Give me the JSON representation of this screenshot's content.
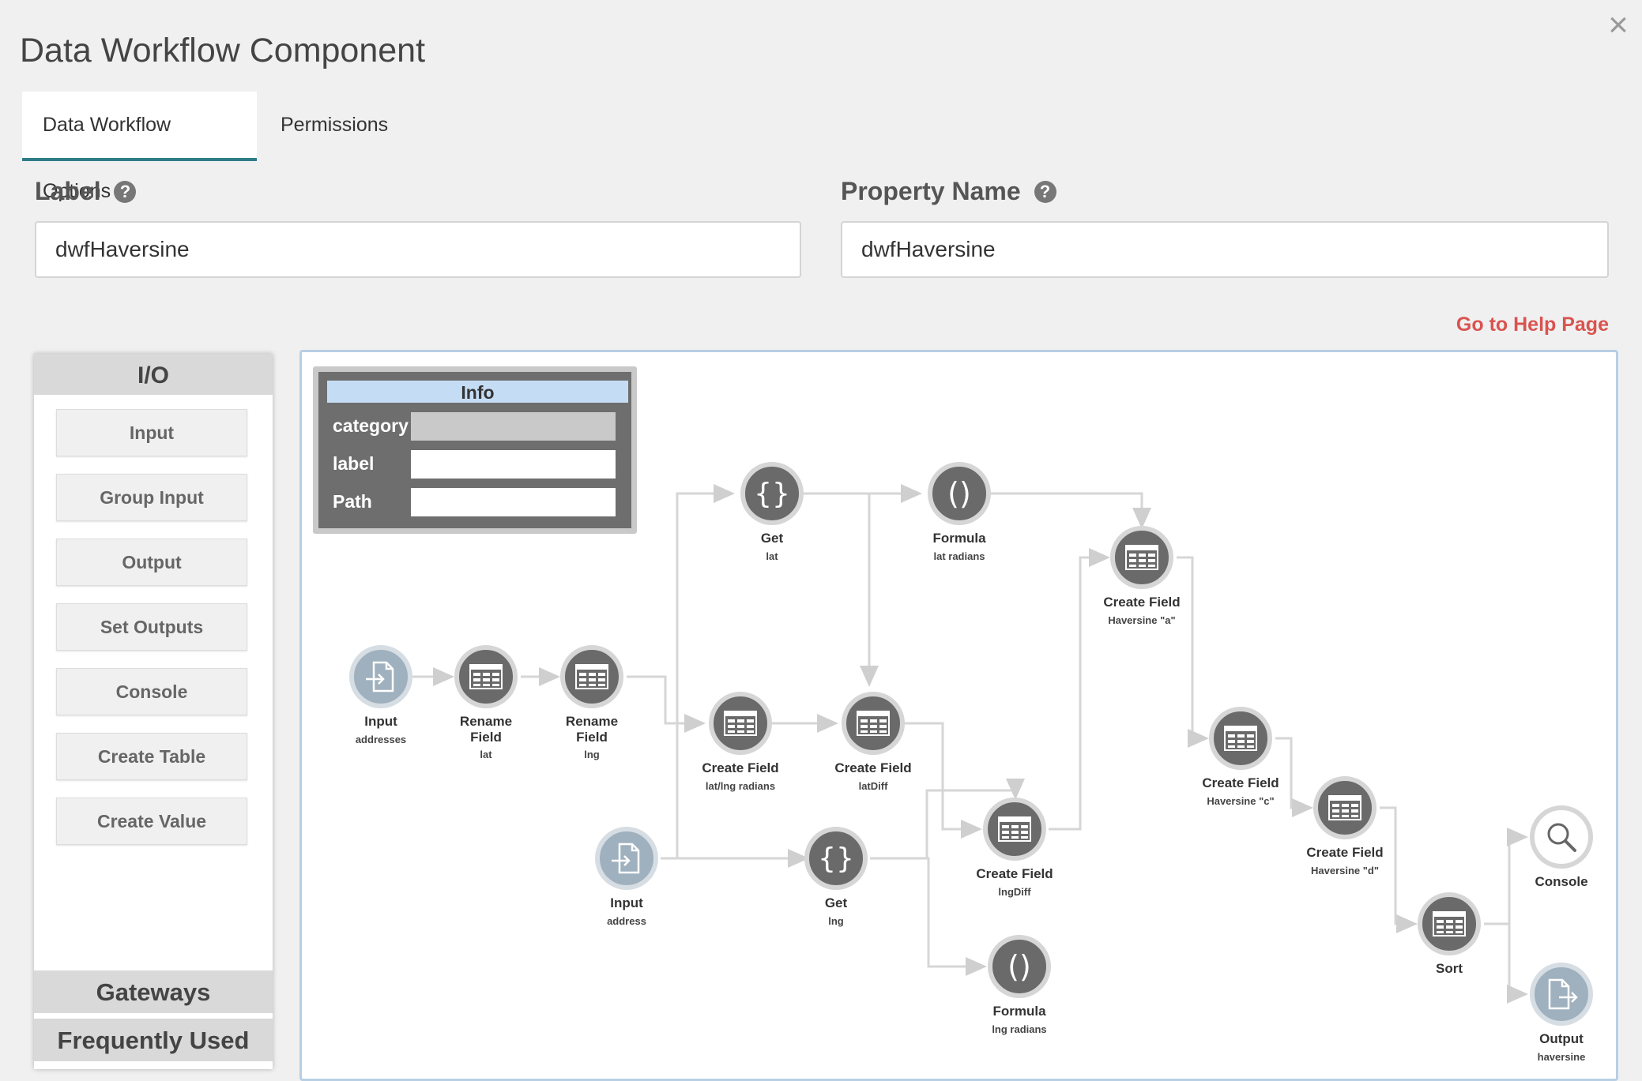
{
  "dialog": {
    "title": "Data Workflow Component",
    "close_glyph": "×"
  },
  "tabs": [
    {
      "label": "Data Workflow Options",
      "active": true
    },
    {
      "label": "Permissions",
      "active": false
    }
  ],
  "form": {
    "label_field": {
      "label": "Label",
      "value": "dwfHaversine"
    },
    "property_field": {
      "label": "Property Name",
      "value": "dwfHaversine"
    },
    "help_glyph": "?"
  },
  "help_link": "Go to Help Page",
  "palette": {
    "io_header": "I/O",
    "io_items": [
      "Input",
      "Group Input",
      "Output",
      "Set Outputs",
      "Console",
      "Create Table",
      "Create Value"
    ],
    "gateways_header": "Gateways",
    "frequent_header": "Frequently Used"
  },
  "info_box": {
    "title": "Info",
    "rows": [
      "category",
      "label",
      "Path"
    ]
  },
  "nodes": [
    {
      "name": "Input",
      "sub": "addresses",
      "icon": "input-icon"
    },
    {
      "name": "Rename Field",
      "sub": "lat",
      "icon": "table-icon"
    },
    {
      "name": "Rename Field",
      "sub": "lng",
      "icon": "table-icon"
    },
    {
      "name": "Get",
      "sub": "lat",
      "icon": "braces-icon"
    },
    {
      "name": "Formula",
      "sub": "lat radians",
      "icon": "parentheses-icon"
    },
    {
      "name": "Create Field",
      "sub": "lat/lng radians",
      "icon": "table-icon"
    },
    {
      "name": "Create Field",
      "sub": "latDiff",
      "icon": "table-icon"
    },
    {
      "name": "Create Field",
      "sub": "Haversine \"a\"",
      "icon": "table-icon"
    },
    {
      "name": "Input",
      "sub": "address",
      "icon": "input-icon"
    },
    {
      "name": "Get",
      "sub": "lng",
      "icon": "braces-icon"
    },
    {
      "name": "Create Field",
      "sub": "lngDiff",
      "icon": "table-icon"
    },
    {
      "name": "Formula",
      "sub": "lng radians",
      "icon": "parentheses-icon"
    },
    {
      "name": "Create Field",
      "sub": "Haversine \"c\"",
      "icon": "table-icon"
    },
    {
      "name": "Create Field",
      "sub": "Haversine \"d\"",
      "icon": "table-icon"
    },
    {
      "name": "Sort",
      "sub": "",
      "icon": "table-icon"
    },
    {
      "name": "Console",
      "sub": "",
      "icon": "magnifier-icon"
    },
    {
      "name": "Output",
      "sub": "haversine",
      "icon": "output-icon"
    }
  ]
}
